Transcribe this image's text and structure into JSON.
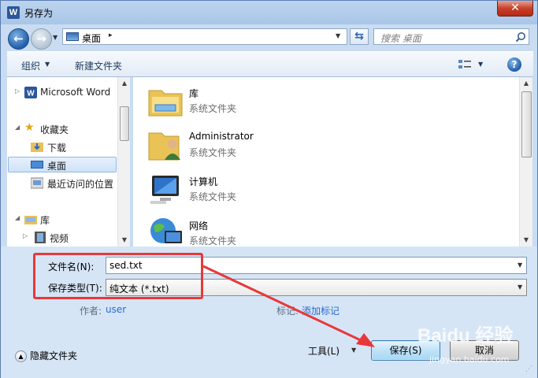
{
  "window": {
    "title": "另存为",
    "app_icon_letter": "W",
    "close_glyph": "✕"
  },
  "address": {
    "location": "桌面",
    "separator": "▸",
    "placeholder": "搜索 桌面"
  },
  "toolbar": {
    "organize": "组织",
    "new_folder": "新建文件夹",
    "help": "?"
  },
  "nav": {
    "items": [
      {
        "label": "Microsoft Word",
        "icon": "word-icon"
      },
      {
        "label": "收藏夹",
        "icon": "star-icon"
      },
      {
        "label": "下载",
        "icon": "download-folder-icon"
      },
      {
        "label": "桌面",
        "icon": "desktop-icon",
        "selected": true
      },
      {
        "label": "最近访问的位置",
        "icon": "recent-places-icon"
      },
      {
        "label": "库",
        "icon": "library-icon"
      },
      {
        "label": "视频",
        "icon": "video-icon"
      }
    ]
  },
  "files": [
    {
      "name": "库",
      "type": "系统文件夹",
      "icon": "library-folder-icon"
    },
    {
      "name": "Administrator",
      "type": "系统文件夹",
      "icon": "user-folder-icon"
    },
    {
      "name": "计算机",
      "type": "系统文件夹",
      "icon": "computer-icon"
    },
    {
      "name": "网络",
      "type": "系统文件夹",
      "icon": "network-icon"
    }
  ],
  "form": {
    "filename_label": "文件名(N):",
    "filename_value": "sed.txt",
    "filetype_label": "保存类型(T):",
    "filetype_value": "纯文本 (*.txt)",
    "author_label": "作者:",
    "author_value": "user",
    "tags_label": "标记:",
    "tags_value": "添加标记"
  },
  "footer": {
    "hide_folders": "隐藏文件夹",
    "tools": "工具(L)",
    "save": "保存(S)",
    "cancel": "取消"
  },
  "watermark": {
    "brand": "Baidu 经验",
    "url": "jingyan.baidu.com"
  },
  "colors": {
    "annotation": "#e8383a",
    "accent": "#2b579a",
    "link": "#2a6ad0"
  }
}
